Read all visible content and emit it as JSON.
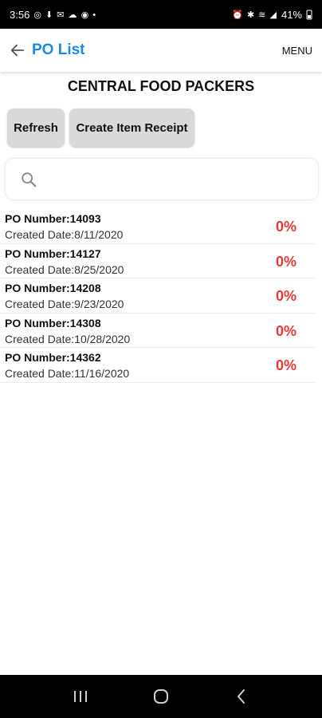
{
  "status_bar": {
    "time": "3:56",
    "battery": "41%"
  },
  "header": {
    "title": "PO List",
    "menu_label": "MENU"
  },
  "company": {
    "name": "CENTRAL FOOD PACKERS"
  },
  "actions": {
    "refresh_label": "Refresh",
    "create_label": "Create Item Receipt"
  },
  "search": {
    "placeholder": ""
  },
  "po_list": [
    {
      "number": "PO Number:14093",
      "date": "Created Date:8/11/2020",
      "percent": "0%"
    },
    {
      "number": "PO Number:14127",
      "date": "Created Date:8/25/2020",
      "percent": "0%"
    },
    {
      "number": "PO Number:14208",
      "date": "Created Date:9/23/2020",
      "percent": "0%"
    },
    {
      "number": "PO Number:14308",
      "date": "Created Date:10/28/2020",
      "percent": "0%"
    },
    {
      "number": "PO Number:14362",
      "date": "Created Date:11/16/2020",
      "percent": "0%"
    }
  ],
  "colors": {
    "accent": "#1e88e5",
    "percent": "#e53935",
    "button_bg": "#d9d9d9"
  }
}
